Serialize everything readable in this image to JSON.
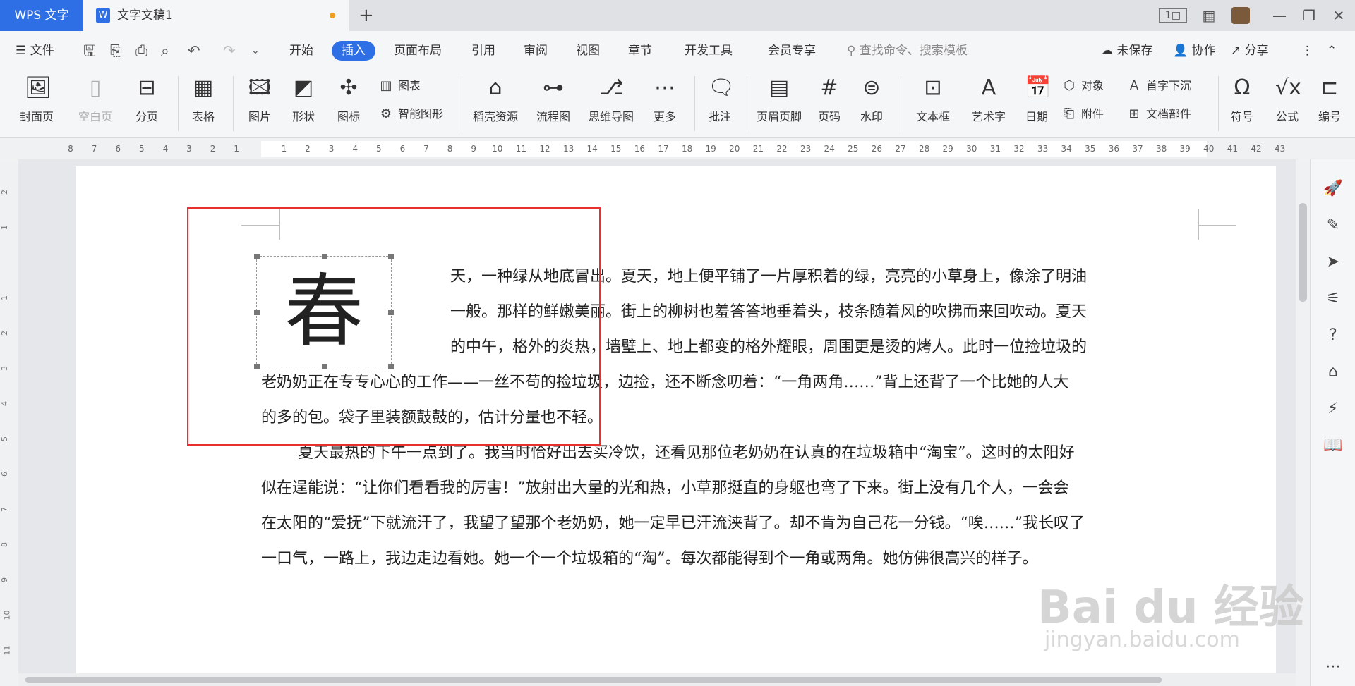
{
  "titlebar": {
    "app_tab": "WPS 文字",
    "doc_tab": "文字文稿1",
    "doc_icon": "W",
    "new_tab": "+",
    "page_view": "1□"
  },
  "menu": {
    "file": "文件",
    "tabs": [
      "开始",
      "插入",
      "页面布局",
      "引用",
      "审阅",
      "视图",
      "章节",
      "开发工具",
      "会员专享"
    ],
    "active_tab": "插入",
    "search_placeholder": "查找命令、搜索模板",
    "unsaved": "未保存",
    "collab": "协作",
    "share": "分享"
  },
  "ribbon": {
    "cover": "封面页",
    "blank": "空白页",
    "pagebreak": "分页",
    "table": "表格",
    "picture": "图片",
    "shape": "形状",
    "iconlib": "图标",
    "chart": "图表",
    "smartart": "智能图形",
    "docer": "稻壳资源",
    "flowchart": "流程图",
    "mindmap": "思维导图",
    "more": "更多",
    "comment": "批注",
    "header": "页眉页脚",
    "pagenum": "页码",
    "watermark": "水印",
    "textbox": "文本框",
    "wordart": "艺术字",
    "date": "日期",
    "object": "对象",
    "attachment": "附件",
    "dropcap": "首字下沉",
    "docparts": "文档部件",
    "symbol": "符号",
    "formula": "公式",
    "edit": "编号"
  },
  "ruler": {
    "ticks": [
      "8",
      "7",
      "6",
      "5",
      "4",
      "3",
      "2",
      "1",
      "",
      "1",
      "2",
      "3",
      "4",
      "5",
      "6",
      "7",
      "8",
      "9",
      "10",
      "11",
      "12",
      "13",
      "14",
      "15",
      "16",
      "17",
      "18",
      "19",
      "20",
      "21",
      "22",
      "23",
      "24",
      "25",
      "26",
      "27",
      "28",
      "29",
      "30",
      "31",
      "32",
      "33",
      "34",
      "35",
      "36",
      "37",
      "38",
      "39",
      "40",
      "41",
      "42",
      "43"
    ]
  },
  "vruler": {
    "ticks": [
      "2",
      "1",
      "",
      "1",
      "2",
      "3",
      "4",
      "5",
      "6",
      "7",
      "8",
      "9",
      "10",
      "11"
    ]
  },
  "document": {
    "dropcap": "春",
    "p1_lines": [
      "天，一种绿从地底冒出。夏天，地上便平铺了一片厚积着的绿，亮亮的小草身上，像涂了明油",
      "一般。那样的鲜嫩美丽。街上的柳树也羞答答地垂着头，枝条随着风的吹拂而来回吹动。夏天",
      "的中午，格外的炎热，墙壁上、地上都变的格外耀眼，周围更是烫的烤人。此时一位捡垃圾的"
    ],
    "p1_full_lines": [
      "老奶奶正在专专心心的工作——一丝不苟的捡垃圾，边捡，还不断念叨着：“一角两角……”背上还背了一个比她的人大",
      "的多的包。袋子里装额鼓鼓的，估计分量也不轻。"
    ],
    "p2_lines": [
      "夏天最热的下午一点到了。我当时恰好出去买冷饮，还看见那位老奶奶在认真的在垃圾箱中“淘宝”。这时的太阳好",
      "似在逞能说：“让你们看看我的厉害！”放射出大量的光和热，小草那挺直的身躯也弯了下来。街上没有几个人，一会会",
      "在太阳的“爱抚”下就流汗了，我望了望那个老奶奶，她一定早已汗流浃背了。却不肯为自己花一分钱。“唉……”我长叹了",
      "一口气，一路上，我边走边看她。她一个一个垃圾箱的“淘”。每次都能得到个一角或两角。她仿佛很高兴的样子。"
    ]
  },
  "watermark": {
    "logo": "Bai du 经验",
    "url": "jingyan.baidu.com"
  },
  "colors": {
    "accent": "#2f6fe6",
    "highlight_box": "#e8302e"
  }
}
